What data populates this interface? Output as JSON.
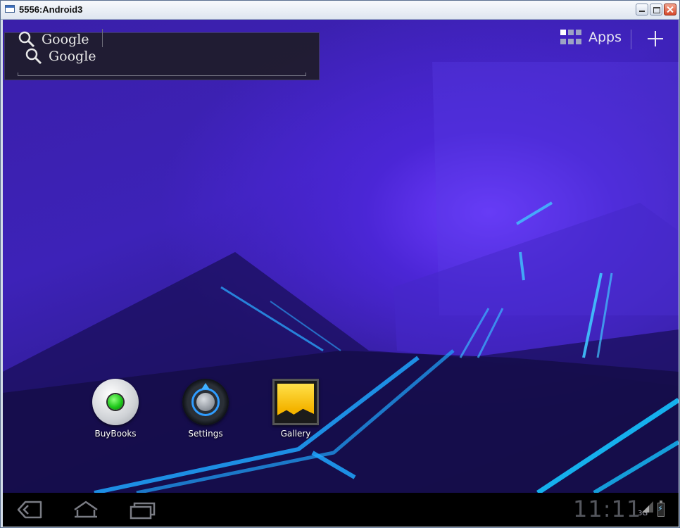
{
  "window": {
    "title": "5556:Android3"
  },
  "search_widget": {
    "primary_label": "Google",
    "secondary_label": "Google"
  },
  "top_bar": {
    "apps_label": "Apps"
  },
  "shortcuts": [
    {
      "label": "BuyBooks",
      "icon": "buybooks-icon"
    },
    {
      "label": "Settings",
      "icon": "settings-icon"
    },
    {
      "label": "Gallery",
      "icon": "gallery-icon"
    }
  ],
  "system_bar": {
    "time": "11:11",
    "network": "3G",
    "icons": [
      "back-icon",
      "home-icon",
      "recent-apps-icon",
      "signal-icon",
      "battery-icon"
    ]
  },
  "colors": {
    "wallpaper_primary": "#3d22b8",
    "accent_blue": "#2f9cff",
    "system_bar": "#000000"
  }
}
